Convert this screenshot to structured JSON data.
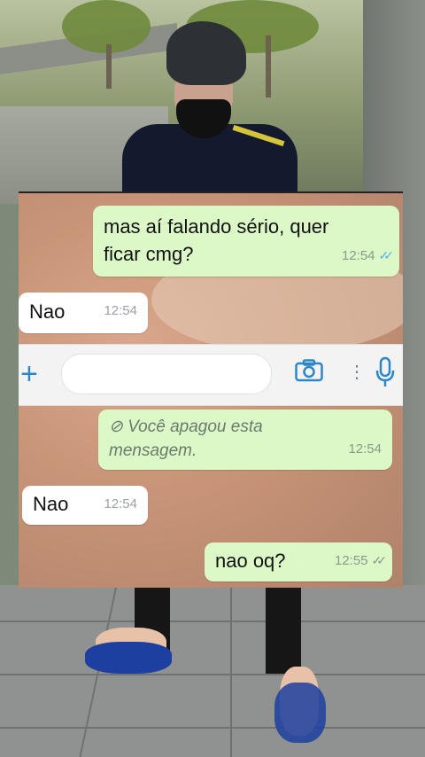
{
  "messages": [
    {
      "side": "out",
      "text_lines": [
        "mas aí falando sério, quer",
        "ficar cmg?"
      ],
      "time": "12:54",
      "status": "read"
    },
    {
      "side": "in",
      "text": "Nao",
      "time": "12:54"
    },
    {
      "side": "out",
      "deleted": true,
      "text_lines": [
        "Você apagou esta",
        "mensagem."
      ],
      "time": "12:54"
    },
    {
      "side": "in",
      "text": "Nao",
      "time": "12:54"
    },
    {
      "side": "out",
      "text": "nao oq?",
      "time": "12:55",
      "status": "delivered"
    }
  ],
  "input_bar": {
    "icons": [
      "plus-icon",
      "camera-icon",
      "more-icon",
      "microphone-icon"
    ],
    "accent": "#2c86c8"
  },
  "colors": {
    "outgoing_bubble": "#dcf8c6",
    "incoming_bubble": "#ffffff",
    "read_ticks": "#4fb6ec"
  }
}
